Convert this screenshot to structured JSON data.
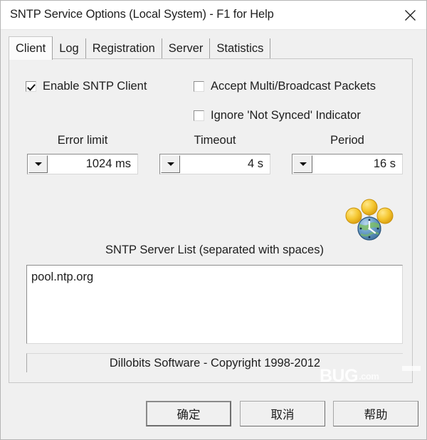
{
  "window": {
    "title": "SNTP Service Options (Local System) - F1 for Help",
    "close_icon": "close-icon"
  },
  "tabs": [
    {
      "label": "Client",
      "selected": true
    },
    {
      "label": "Log",
      "selected": false
    },
    {
      "label": "Registration",
      "selected": false
    },
    {
      "label": "Server",
      "selected": false
    },
    {
      "label": "Statistics",
      "selected": false
    }
  ],
  "client_tab": {
    "checkboxes": [
      {
        "label": "Enable SNTP Client",
        "checked": true
      },
      {
        "label": "Accept Multi/Broadcast Packets",
        "checked": false
      },
      {
        "label": "Ignore 'Not Synced' Indicator",
        "checked": false
      }
    ],
    "fields": [
      {
        "label": "Error limit",
        "value": "1024 ms"
      },
      {
        "label": "Timeout",
        "value": "4 s"
      },
      {
        "label": "Period",
        "value": "16 s"
      }
    ],
    "sync_icon": "network-time-sync-icon",
    "server_list": {
      "label": "SNTP Server List (separated with spaces)",
      "value": "pool.ntp.org"
    },
    "copyright": "Dillobits Software - Copyright 1998-2012"
  },
  "watermark": {
    "main": "BUG",
    "suffix": ".com"
  },
  "buttons": [
    {
      "label": "确定",
      "default": true
    },
    {
      "label": "取消",
      "default": false
    },
    {
      "label": "帮助",
      "default": false
    }
  ],
  "colors": {
    "dialog_face": "#f0f0f0",
    "titlebar": "#ffffff",
    "field_bg": "#ffffff",
    "text": "#1d1d1d",
    "icon_gold": "#f2c33c",
    "icon_globe": "#5a8fc0"
  }
}
